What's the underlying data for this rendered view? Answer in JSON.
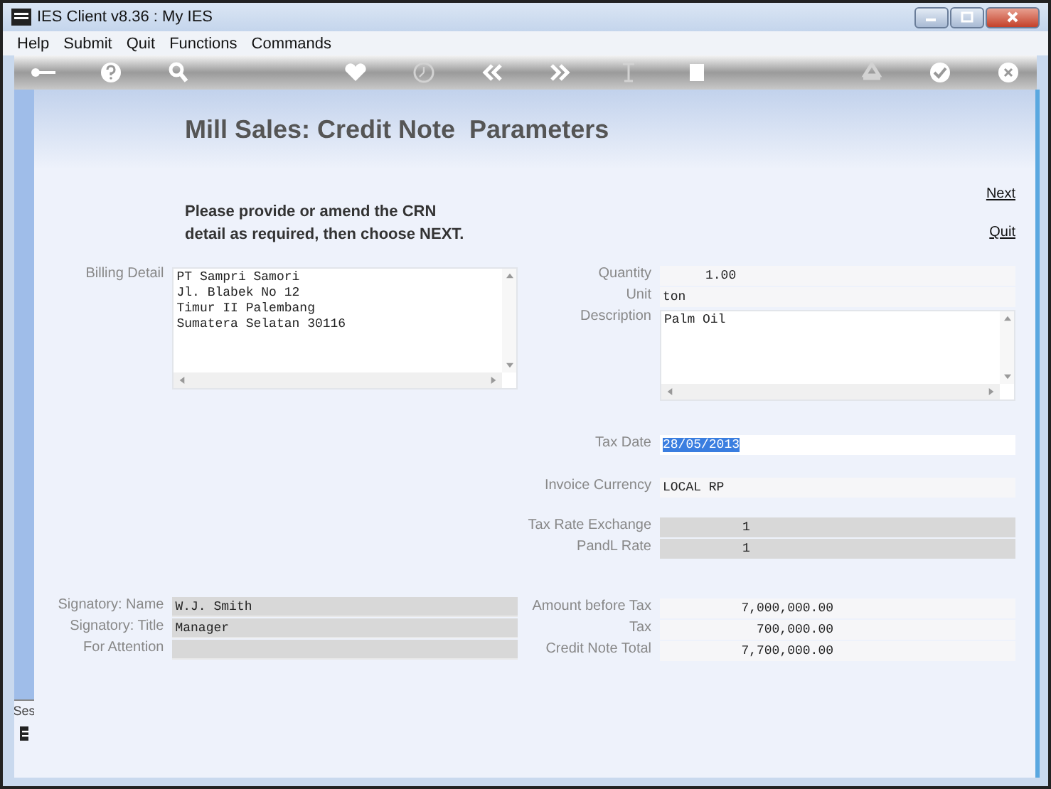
{
  "window": {
    "title": "IES Client v8.36 : My IES"
  },
  "menu": [
    "Help",
    "Submit",
    "Quit",
    "Functions",
    "Commands"
  ],
  "toolbar": [
    {
      "kind": "key",
      "disabled": false
    },
    {
      "kind": "help",
      "disabled": false
    },
    {
      "kind": "search",
      "disabled": false
    },
    {
      "kind": "heart",
      "disabled": false
    },
    {
      "kind": "clock",
      "disabled": true
    },
    {
      "kind": "back",
      "disabled": false
    },
    {
      "kind": "forward",
      "disabled": false
    },
    {
      "kind": "text",
      "disabled": true
    },
    {
      "kind": "stop",
      "disabled": false
    },
    {
      "kind": "recycle",
      "disabled": true
    },
    {
      "kind": "check",
      "disabled": false
    },
    {
      "kind": "close",
      "disabled": false
    }
  ],
  "heading": "Mill Sales: Credit Note  Parameters",
  "instructions": [
    "Please provide or amend the CRN",
    "detail as required, then choose NEXT."
  ],
  "links": [
    "Next",
    "Quit"
  ],
  "billing": {
    "label": "Billing Detail",
    "lines": [
      "PT Sampri Samori",
      "Jl. Blabek No 12",
      "Timur II Palembang",
      "Sumatera Selatan 30116"
    ]
  },
  "item": {
    "quantity": {
      "label": "Quantity",
      "value": "1.00"
    },
    "unit": {
      "label": "Unit",
      "value": "ton"
    },
    "description": {
      "label": "Description",
      "lines": [
        "Palm Oil"
      ]
    }
  },
  "tax_date": {
    "label": "Tax Date",
    "value": "28/05/2013",
    "selected": true
  },
  "currency": {
    "label": "Invoice Currency",
    "value": "LOCAL RP"
  },
  "rates": [
    {
      "label": "Tax Rate Exchange",
      "value": "1"
    },
    {
      "label": "PandL Rate",
      "value": "1"
    }
  ],
  "signatory": [
    {
      "label": "Signatory: Name",
      "value": "W.J. Smith"
    },
    {
      "label": "Signatory: Title",
      "value": "Manager"
    },
    {
      "label": "For Attention"
    }
  ],
  "totals": [
    {
      "label": "Amount before Tax",
      "value": "7,000,000.00"
    },
    {
      "label": "Tax",
      "value": "700,000.00"
    },
    {
      "label": "Credit Note Total",
      "value": "7,700,000.00"
    }
  ],
  "side_panel": {
    "label": "Ses"
  }
}
